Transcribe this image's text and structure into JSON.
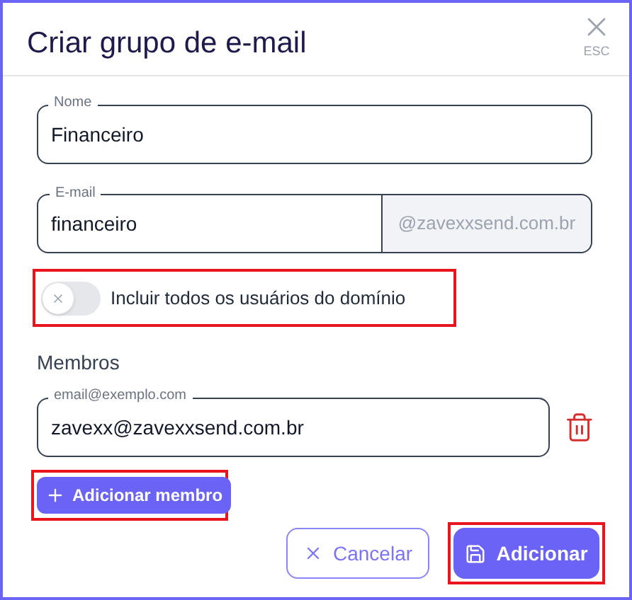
{
  "dialog": {
    "title": "Criar grupo de e-mail",
    "close_hint": "ESC"
  },
  "name_field": {
    "label": "Nome",
    "value": "Financeiro"
  },
  "email_field": {
    "label": "E-mail",
    "value": "financeiro",
    "suffix": "@zavexxsend.com.br"
  },
  "include_all_toggle": {
    "label": "Incluir todos os usuários do domínio",
    "on": false,
    "highlighted": true
  },
  "members": {
    "heading": "Membros",
    "items": [
      {
        "label": "email@exemplo.com",
        "value": "zavexx@zavexxsend.com.br"
      }
    ],
    "add_button": {
      "label": "Adicionar membro",
      "highlighted": true
    }
  },
  "buttons": [
    {
      "kind": "cancel",
      "label": "Cancelar",
      "highlighted": false
    },
    {
      "kind": "submit",
      "label": "Adicionar",
      "highlighted": true
    }
  ]
}
